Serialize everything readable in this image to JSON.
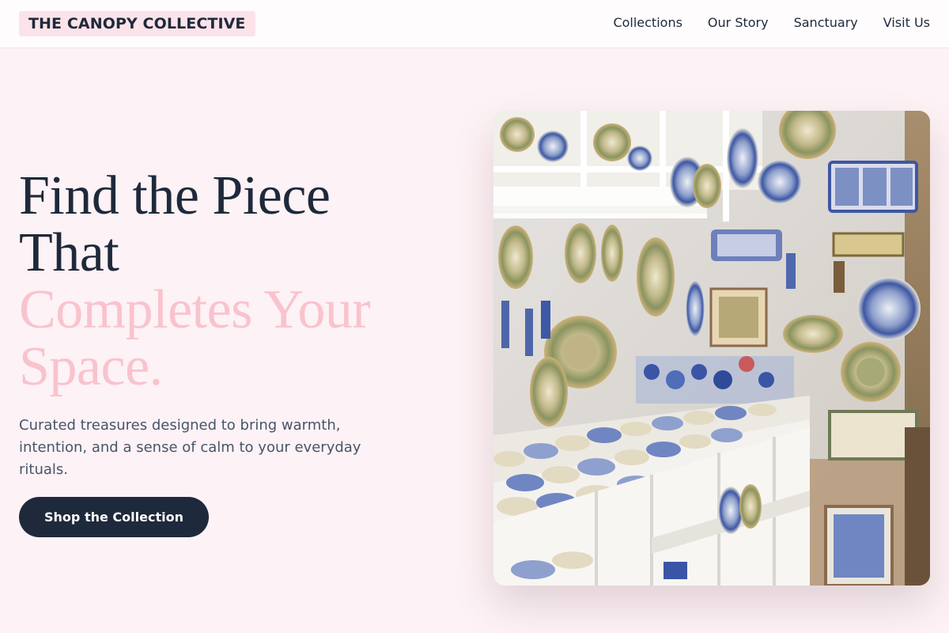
{
  "brand": {
    "name": "THE CANOPY COLLECTIVE"
  },
  "nav": {
    "items": [
      {
        "label": "Collections"
      },
      {
        "label": "Our Story"
      },
      {
        "label": "Sanctuary"
      },
      {
        "label": "Visit Us"
      }
    ]
  },
  "hero": {
    "headline_dark": [
      "Find the Piece",
      "That"
    ],
    "headline_accent": [
      "Completes Your",
      "Space."
    ],
    "subtext": "Curated treasures designed to bring warmth, intention, and a sense of calm to your everyday rituals.",
    "cta_label": "Shop the Collection",
    "image_alt": "Shop wall with shelves of hand-painted blue and white ceramic plates, jugs and tiles"
  },
  "colors": {
    "page_bg": "#fdf2f5",
    "text_dark": "#1e293b",
    "accent_pink": "#f9c3cd",
    "muted_text": "#475569"
  }
}
